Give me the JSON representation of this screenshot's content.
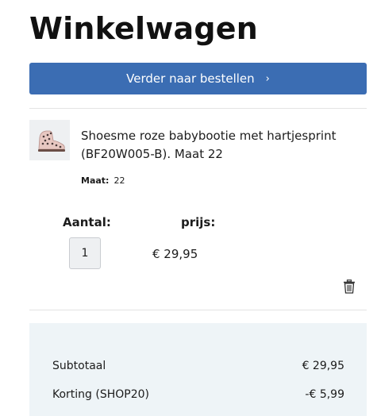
{
  "header": {
    "title": "Winkelwagen"
  },
  "checkout": {
    "label": "Verder naar bestellen",
    "chevron": "›"
  },
  "item": {
    "image_icon": "pink-baby-bootie-image",
    "name": "Shoesme roze babybootie met hartjesprint (BF20W005-B). Maat 22",
    "size_label": "Maat:",
    "size_value": "22",
    "qty_label": "Aantal:",
    "price_label": "prijs:",
    "qty_value": "1",
    "price_value": "€ 29,95"
  },
  "summary": {
    "subtotal_label": "Subtotaal",
    "subtotal_value": "€ 29,95",
    "discount_label": "Korting (SHOP20)",
    "discount_value": "-€ 5,99"
  },
  "colors": {
    "accent": "#3b6db3",
    "summary_bg": "#eef4f7"
  }
}
